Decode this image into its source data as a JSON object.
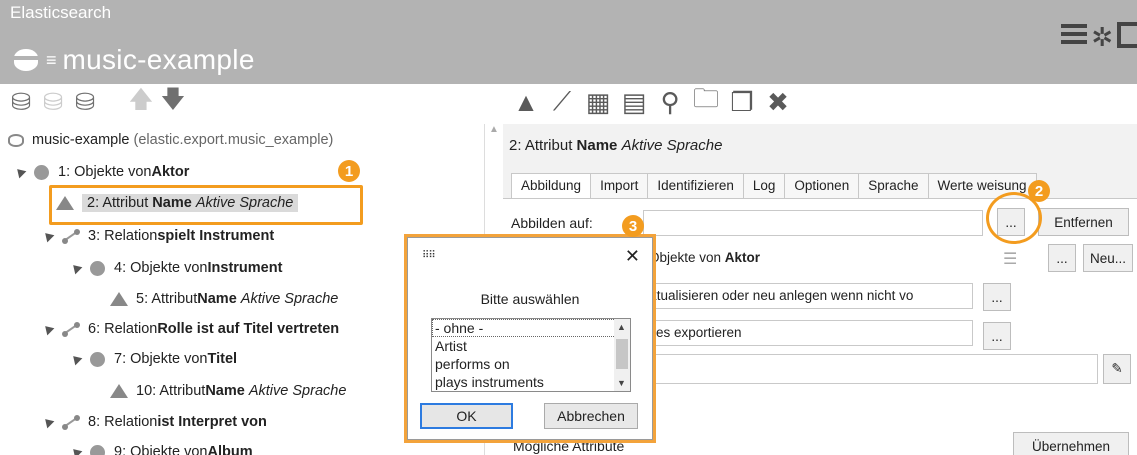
{
  "app": {
    "brand": "Elasticsearch",
    "db_name": "music-example"
  },
  "colors": {
    "header_bg": "#b3b3b3",
    "callout": "#f39c1f",
    "focus_border": "#2d7be0"
  },
  "header_icons": [
    "menu-icon",
    "gear-icon",
    "window-icon"
  ],
  "left_toolbar": [
    "upload-db-icon",
    "db-icon",
    "download-db-icon",
    "arrow-up-icon",
    "arrow-down-icon"
  ],
  "right_toolbar": [
    "triangle-icon",
    "relation-icon",
    "qr-icon",
    "list-icon",
    "search-icon",
    "folder-icon",
    "copy-icon",
    "delete-icon"
  ],
  "tree": {
    "root_name": "music-example",
    "root_path": "(elastic.export.music_example)",
    "nodes": [
      {
        "prefix": "1: Objekte von ",
        "bold": "Aktor",
        "italic": ""
      },
      {
        "prefix": "2: Attribut ",
        "bold": "Name",
        "italic": "Aktive Sprache"
      },
      {
        "prefix": "3: Relation ",
        "bold": "spielt Instrument",
        "italic": ""
      },
      {
        "prefix": "4: Objekte von ",
        "bold": "Instrument",
        "italic": ""
      },
      {
        "prefix": "5: Attribut ",
        "bold": "Name",
        "italic": "Aktive Sprache"
      },
      {
        "prefix": "6: Relation ",
        "bold": "Rolle ist auf Titel vertreten",
        "italic": ""
      },
      {
        "prefix": "7: Objekte von ",
        "bold": "Titel",
        "italic": ""
      },
      {
        "prefix": "10: Attribut ",
        "bold": "Name",
        "italic": "Aktive Sprache"
      },
      {
        "prefix": "8: Relation ",
        "bold": "ist Interpret von",
        "italic": ""
      },
      {
        "prefix": "9: Objekte von ",
        "bold": "Album",
        "italic": ""
      }
    ]
  },
  "detail": {
    "title_prefix": "2: Attribut ",
    "title_bold": "Name",
    "title_italic": "Aktive Sprache",
    "tabs": [
      "Abbildung",
      "Import",
      "Identifizieren",
      "Log",
      "Optionen",
      "Sprache",
      "Werte weisung"
    ],
    "active_tab": "Abbildung",
    "map_label": "Abbilden auf:",
    "map_value": "",
    "browse_label": "...",
    "remove_label": "Entfernen",
    "object_value": "Objekte von ",
    "object_bold": "Aktor",
    "new_label": "Neu...",
    "mode_value": "ktualisieren oder neu anlegen wenn nicht vo",
    "export_value": "lles exportieren",
    "possible_attrs_label": "Mögliche Attribute",
    "apply_label": "Übernehmen"
  },
  "dialog": {
    "prompt": "Bitte auswählen",
    "options": [
      "- ohne -",
      "Artist",
      "performs on",
      "plays instruments"
    ],
    "selected": "- ohne -",
    "ok_label": "OK",
    "cancel_label": "Abbrechen",
    "close_label": "✕"
  },
  "callouts": [
    "1",
    "2",
    "3"
  ]
}
